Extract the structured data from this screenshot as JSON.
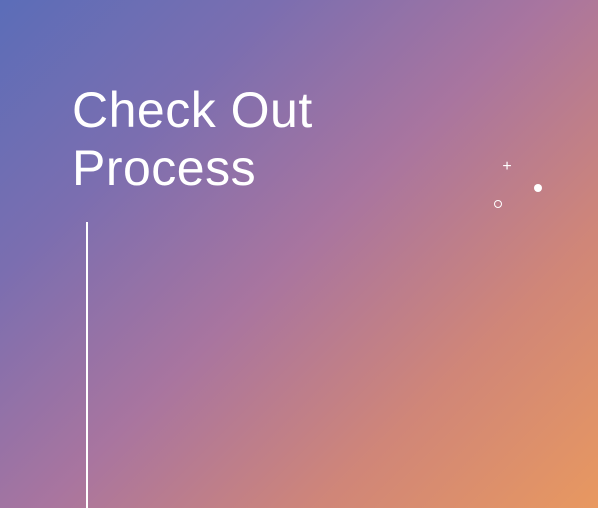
{
  "slide": {
    "title_line1": "Check Out",
    "title_line2": "Process"
  }
}
